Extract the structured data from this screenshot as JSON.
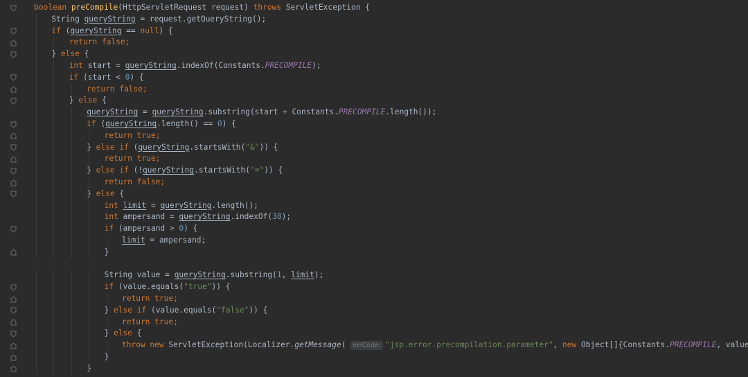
{
  "editor": {
    "lines": [
      [
        {
          "t": "boolean ",
          "c": "kw"
        },
        {
          "t": "preCompile",
          "c": "fn"
        },
        {
          "t": "(HttpServletRequest request) "
        },
        {
          "t": "throws ",
          "c": "kw"
        },
        {
          "t": "ServletException {"
        }
      ],
      [
        {
          "t": "String "
        },
        {
          "t": "queryString",
          "c": "ul"
        },
        {
          "t": " = request.getQueryString();"
        }
      ],
      [
        {
          "t": "if ",
          "c": "kw"
        },
        {
          "t": "("
        },
        {
          "t": "queryString",
          "c": "ul"
        },
        {
          "t": " == "
        },
        {
          "t": "null",
          "c": "kw"
        },
        {
          "t": ") {"
        }
      ],
      [
        {
          "t": "return false;",
          "c": "kw"
        }
      ],
      [
        {
          "t": "} "
        },
        {
          "t": "else ",
          "c": "kw"
        },
        {
          "t": "{"
        }
      ],
      [
        {
          "t": "int ",
          "c": "kw"
        },
        {
          "t": "start = "
        },
        {
          "t": "queryString",
          "c": "ul"
        },
        {
          "t": ".indexOf(Constants."
        },
        {
          "t": "PRECOMPILE",
          "c": "const"
        },
        {
          "t": ");"
        }
      ],
      [
        {
          "t": "if ",
          "c": "kw"
        },
        {
          "t": "(start < "
        },
        {
          "t": "0",
          "c": "num"
        },
        {
          "t": ") {"
        }
      ],
      [
        {
          "t": "return false;",
          "c": "kw"
        }
      ],
      [
        {
          "t": "} "
        },
        {
          "t": "else ",
          "c": "kw"
        },
        {
          "t": "{"
        }
      ],
      [
        {
          "t": "queryString",
          "c": "ul"
        },
        {
          "t": " = "
        },
        {
          "t": "queryString",
          "c": "ul"
        },
        {
          "t": ".substring(start + Constants."
        },
        {
          "t": "PRECOMPILE",
          "c": "const"
        },
        {
          "t": ".length());"
        }
      ],
      [
        {
          "t": "if ",
          "c": "kw"
        },
        {
          "t": "("
        },
        {
          "t": "queryString",
          "c": "ul"
        },
        {
          "t": ".length() == "
        },
        {
          "t": "0",
          "c": "num"
        },
        {
          "t": ") {"
        }
      ],
      [
        {
          "t": "return true;",
          "c": "kw"
        }
      ],
      [
        {
          "t": "} "
        },
        {
          "t": "else if ",
          "c": "kw"
        },
        {
          "t": "("
        },
        {
          "t": "queryString",
          "c": "ul"
        },
        {
          "t": ".startsWith("
        },
        {
          "t": "\"&\"",
          "c": "str"
        },
        {
          "t": ")) {"
        }
      ],
      [
        {
          "t": "return true;",
          "c": "kw"
        }
      ],
      [
        {
          "t": "} "
        },
        {
          "t": "else if ",
          "c": "kw"
        },
        {
          "t": "(!"
        },
        {
          "t": "queryString",
          "c": "ul"
        },
        {
          "t": ".startsWith("
        },
        {
          "t": "\"=\"",
          "c": "str"
        },
        {
          "t": ")) {"
        }
      ],
      [
        {
          "t": "return false;",
          "c": "kw"
        }
      ],
      [
        {
          "t": "} "
        },
        {
          "t": "else ",
          "c": "kw"
        },
        {
          "t": "{"
        }
      ],
      [
        {
          "t": "int ",
          "c": "kw"
        },
        {
          "t": "limit",
          "c": "ul"
        },
        {
          "t": " = "
        },
        {
          "t": "queryString",
          "c": "ul"
        },
        {
          "t": ".length();"
        }
      ],
      [
        {
          "t": "int ",
          "c": "kw"
        },
        {
          "t": "ampersand = "
        },
        {
          "t": "queryString",
          "c": "ul"
        },
        {
          "t": ".indexOf("
        },
        {
          "t": "38",
          "c": "num"
        },
        {
          "t": ");"
        }
      ],
      [
        {
          "t": "if ",
          "c": "kw"
        },
        {
          "t": "(ampersand > "
        },
        {
          "t": "0",
          "c": "num"
        },
        {
          "t": ") {"
        }
      ],
      [
        {
          "t": "limit",
          "c": "ul"
        },
        {
          "t": " = ampersand;"
        }
      ],
      [
        {
          "t": "}"
        }
      ],
      [],
      [
        {
          "t": "String value = "
        },
        {
          "t": "queryString",
          "c": "ul"
        },
        {
          "t": ".substring("
        },
        {
          "t": "1",
          "c": "num"
        },
        {
          "t": ", "
        },
        {
          "t": "limit",
          "c": "ul"
        },
        {
          "t": ");"
        }
      ],
      [
        {
          "t": "if ",
          "c": "kw"
        },
        {
          "t": "(value.equals("
        },
        {
          "t": "\"true\"",
          "c": "str"
        },
        {
          "t": ")) {"
        }
      ],
      [
        {
          "t": "return true;",
          "c": "kw"
        }
      ],
      [
        {
          "t": "} "
        },
        {
          "t": "else if ",
          "c": "kw"
        },
        {
          "t": "(value.equals("
        },
        {
          "t": "\"false\"",
          "c": "str"
        },
        {
          "t": ")) {"
        }
      ],
      [
        {
          "t": "return true;",
          "c": "kw"
        }
      ],
      [
        {
          "t": "} "
        },
        {
          "t": "else ",
          "c": "kw"
        },
        {
          "t": "{"
        }
      ],
      [
        {
          "t": "throw new ",
          "c": "kw"
        },
        {
          "t": "ServletException(Localizer."
        },
        {
          "t": "getMessage",
          "c": "static"
        },
        {
          "t": "( "
        },
        {
          "t": "errCode:",
          "c": "hint"
        },
        {
          "t": "\"jsp.error.precompilation.parameter\"",
          "c": "str"
        },
        {
          "t": ", "
        },
        {
          "t": "new ",
          "c": "kw"
        },
        {
          "t": "Object[]{Constants."
        },
        {
          "t": "PRECOMPILE",
          "c": "const"
        },
        {
          "t": ", value}));"
        }
      ],
      [
        {
          "t": "}"
        }
      ],
      [
        {
          "t": "}"
        }
      ]
    ]
  }
}
